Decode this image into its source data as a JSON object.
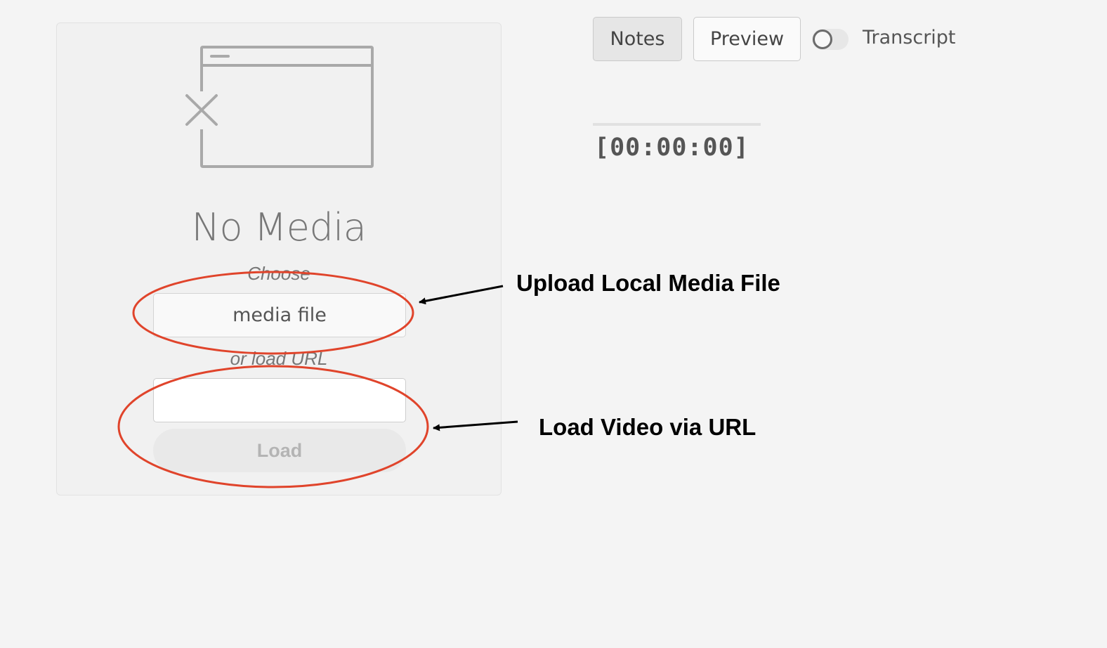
{
  "media_panel": {
    "icon": "no-media-window-icon",
    "title": "No Media",
    "choose_label": "Choose",
    "file_button_label": "media file",
    "url_label": "or load URL",
    "url_input_value": "",
    "load_button_label": "Load"
  },
  "tabs": {
    "notes_label": "Notes",
    "preview_label": "Preview",
    "transcript_label": "Transcript",
    "transcript_enabled": false
  },
  "timecode": "[00:00:00]",
  "annotations": {
    "upload_label": "Upload Local Media File",
    "url_label": "Load Video via URL",
    "highlight_color": "#e0442b",
    "arrow_color": "#000000"
  },
  "colors": {
    "page_background": "#f4f4f4",
    "panel_background": "#f1f1f1",
    "icon_gray": "#a9a9a9"
  }
}
